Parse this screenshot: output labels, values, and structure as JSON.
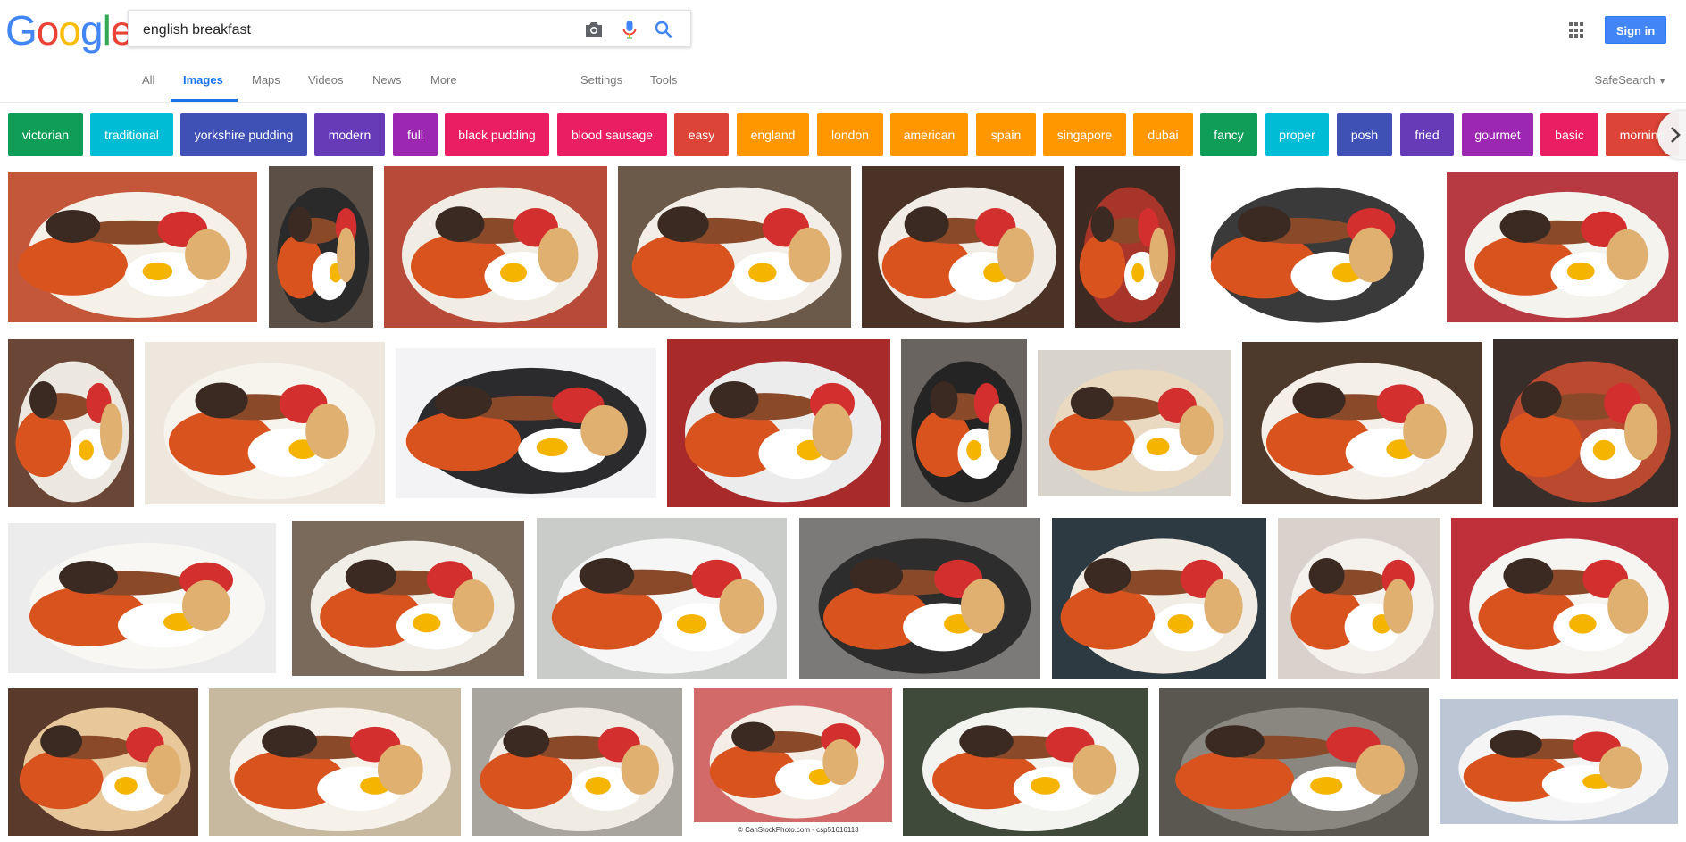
{
  "logo": {
    "letters": [
      "G",
      "o",
      "o",
      "g",
      "l",
      "e"
    ],
    "colors": [
      "#4285f4",
      "#ea4335",
      "#fbbc05",
      "#4285f4",
      "#34a853",
      "#ea4335"
    ]
  },
  "search": {
    "query": "english breakfast"
  },
  "header": {
    "signin_label": "Sign in"
  },
  "nav": {
    "tabs": [
      {
        "label": "All"
      },
      {
        "label": "Images"
      },
      {
        "label": "Maps"
      },
      {
        "label": "Videos"
      },
      {
        "label": "News"
      },
      {
        "label": "More"
      },
      {
        "label": "Settings"
      },
      {
        "label": "Tools"
      }
    ],
    "safesearch_label": "SafeSearch"
  },
  "chips": [
    {
      "label": "victorian",
      "color": "#0f9d58"
    },
    {
      "label": "traditional",
      "color": "#00bcd4"
    },
    {
      "label": "yorkshire pudding",
      "color": "#3f51b5"
    },
    {
      "label": "modern",
      "color": "#673ab7"
    },
    {
      "label": "full",
      "color": "#9c27b0"
    },
    {
      "label": "black pudding",
      "color": "#e91e63"
    },
    {
      "label": "blood sausage",
      "color": "#e91e63"
    },
    {
      "label": "easy",
      "color": "#db4437"
    },
    {
      "label": "england",
      "color": "#ff9800"
    },
    {
      "label": "london",
      "color": "#ff9800"
    },
    {
      "label": "american",
      "color": "#ff9800"
    },
    {
      "label": "spain",
      "color": "#ff9800"
    },
    {
      "label": "singapore",
      "color": "#ff9800"
    },
    {
      "label": "dubai",
      "color": "#ff9800"
    },
    {
      "label": "fancy",
      "color": "#0f9d58"
    },
    {
      "label": "proper",
      "color": "#00bcd4"
    },
    {
      "label": "posh",
      "color": "#3f51b5"
    },
    {
      "label": "fried",
      "color": "#673ab7"
    },
    {
      "label": "gourmet",
      "color": "#9c27b0"
    },
    {
      "label": "basic",
      "color": "#e91e63"
    },
    {
      "label": "morning",
      "color": "#db4437"
    }
  ],
  "image_credit": "© CanStockPhoto.com - csp51616113"
}
